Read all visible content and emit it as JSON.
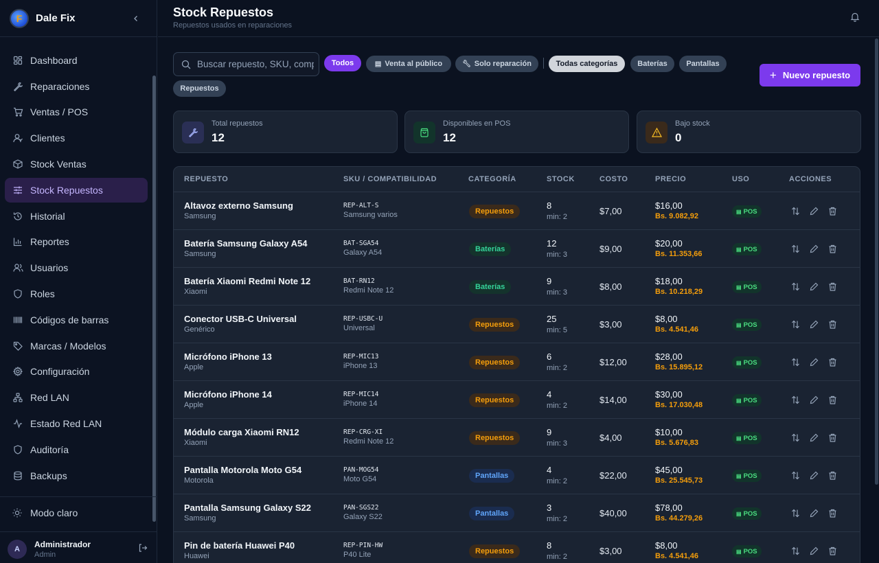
{
  "sidebar": {
    "brand": "Dale Fix",
    "logo_letter": "F",
    "items": [
      {
        "label": "Dashboard",
        "icon": "dashboard-icon"
      },
      {
        "label": "Reparaciones",
        "icon": "wrench-icon"
      },
      {
        "label": "Ventas / POS",
        "icon": "cart-icon"
      },
      {
        "label": "Clientes",
        "icon": "user-icon"
      },
      {
        "label": "Stock Ventas",
        "icon": "box-icon"
      },
      {
        "label": "Stock Repuestos",
        "icon": "sliders-icon",
        "active": true
      },
      {
        "label": "Historial",
        "icon": "history-icon"
      },
      {
        "label": "Reportes",
        "icon": "bar-chart-icon"
      },
      {
        "label": "Usuarios",
        "icon": "users-icon"
      },
      {
        "label": "Roles",
        "icon": "shield-icon"
      },
      {
        "label": "Códigos de barras",
        "icon": "barcode-icon"
      },
      {
        "label": "Marcas / Modelos",
        "icon": "tag-icon"
      },
      {
        "label": "Configuración",
        "icon": "gear-icon"
      },
      {
        "label": "Red LAN",
        "icon": "network-icon"
      },
      {
        "label": "Estado Red LAN",
        "icon": "activity-icon"
      },
      {
        "label": "Auditoría",
        "icon": "shield-icon"
      },
      {
        "label": "Backups",
        "icon": "database-icon"
      }
    ],
    "mode_label": "Modo claro",
    "user": {
      "initial": "A",
      "name": "Administrador",
      "role": "Admin"
    }
  },
  "header": {
    "title": "Stock Repuestos",
    "subtitle": "Repuestos usados en reparaciones"
  },
  "toolbar": {
    "search_placeholder": "Buscar repuesto, SKU, compatibilidad...",
    "filters": {
      "todos": "Todos",
      "venta": "Venta al público",
      "reparacion": "Solo reparación",
      "todas_cat": "Todas categorías",
      "baterias": "Baterías",
      "pantallas": "Pantallas",
      "repuestos": "Repuestos"
    },
    "new_button": "Nuevo repuesto"
  },
  "stats": {
    "total_label": "Total repuestos",
    "total_value": "12",
    "pos_label": "Disponibles en POS",
    "pos_value": "12",
    "low_label": "Bajo stock",
    "low_value": "0"
  },
  "table": {
    "headers": {
      "repuesto": "REPUESTO",
      "sku": "SKU / COMPATIBILIDAD",
      "categoria": "CATEGORÍA",
      "stock": "STOCK",
      "costo": "COSTO",
      "precio": "PRECIO",
      "uso": "USO",
      "acciones": "ACCIONES"
    },
    "rows": [
      {
        "name": "Altavoz externo Samsung",
        "brand": "Samsung",
        "sku": "REP-ALT-S",
        "compat": "Samsung varios",
        "category": "Repuestos",
        "cat_class": "repuestos",
        "stock": "8",
        "min": "min: 2",
        "cost": "$7,00",
        "price": "$16,00",
        "bs": "Bs. 9.082,92",
        "uso": "POS"
      },
      {
        "name": "Batería Samsung Galaxy A54",
        "brand": "Samsung",
        "sku": "BAT-SGA54",
        "compat": "Galaxy A54",
        "category": "Baterías",
        "cat_class": "baterias",
        "stock": "12",
        "min": "min: 3",
        "cost": "$9,00",
        "price": "$20,00",
        "bs": "Bs. 11.353,66",
        "uso": "POS"
      },
      {
        "name": "Batería Xiaomi Redmi Note 12",
        "brand": "Xiaomi",
        "sku": "BAT-RN12",
        "compat": "Redmi Note 12",
        "category": "Baterías",
        "cat_class": "baterias",
        "stock": "9",
        "min": "min: 3",
        "cost": "$8,00",
        "price": "$18,00",
        "bs": "Bs. 10.218,29",
        "uso": "POS"
      },
      {
        "name": "Conector USB-C Universal",
        "brand": "Genérico",
        "sku": "REP-USBC-U",
        "compat": "Universal",
        "category": "Repuestos",
        "cat_class": "repuestos",
        "stock": "25",
        "min": "min: 5",
        "cost": "$3,00",
        "price": "$8,00",
        "bs": "Bs. 4.541,46",
        "uso": "POS"
      },
      {
        "name": "Micrófono iPhone 13",
        "brand": "Apple",
        "sku": "REP-MIC13",
        "compat": "iPhone 13",
        "category": "Repuestos",
        "cat_class": "repuestos",
        "stock": "6",
        "min": "min: 2",
        "cost": "$12,00",
        "price": "$28,00",
        "bs": "Bs. 15.895,12",
        "uso": "POS"
      },
      {
        "name": "Micrófono iPhone 14",
        "brand": "Apple",
        "sku": "REP-MIC14",
        "compat": "iPhone 14",
        "category": "Repuestos",
        "cat_class": "repuestos",
        "stock": "4",
        "min": "min: 2",
        "cost": "$14,00",
        "price": "$30,00",
        "bs": "Bs. 17.030,48",
        "uso": "POS"
      },
      {
        "name": "Módulo carga Xiaomi RN12",
        "brand": "Xiaomi",
        "sku": "REP-CRG-XI",
        "compat": "Redmi Note 12",
        "category": "Repuestos",
        "cat_class": "repuestos",
        "stock": "9",
        "min": "min: 3",
        "cost": "$4,00",
        "price": "$10,00",
        "bs": "Bs. 5.676,83",
        "uso": "POS"
      },
      {
        "name": "Pantalla Motorola Moto G54",
        "brand": "Motorola",
        "sku": "PAN-MOG54",
        "compat": "Moto G54",
        "category": "Pantallas",
        "cat_class": "pantallas",
        "stock": "4",
        "min": "min: 2",
        "cost": "$22,00",
        "price": "$45,00",
        "bs": "Bs. 25.545,73",
        "uso": "POS"
      },
      {
        "name": "Pantalla Samsung Galaxy S22",
        "brand": "Samsung",
        "sku": "PAN-SGS22",
        "compat": "Galaxy S22",
        "category": "Pantallas",
        "cat_class": "pantallas",
        "stock": "3",
        "min": "min: 2",
        "cost": "$40,00",
        "price": "$78,00",
        "bs": "Bs. 44.279,26",
        "uso": "POS"
      },
      {
        "name": "Pin de batería Huawei P40",
        "brand": "Huawei",
        "sku": "REP-PIN-HW",
        "compat": "P40 Lite",
        "category": "Repuestos",
        "cat_class": "repuestos",
        "stock": "8",
        "min": "min: 2",
        "cost": "$3,00",
        "price": "$8,00",
        "bs": "Bs. 4.541,46",
        "uso": "POS"
      }
    ]
  }
}
